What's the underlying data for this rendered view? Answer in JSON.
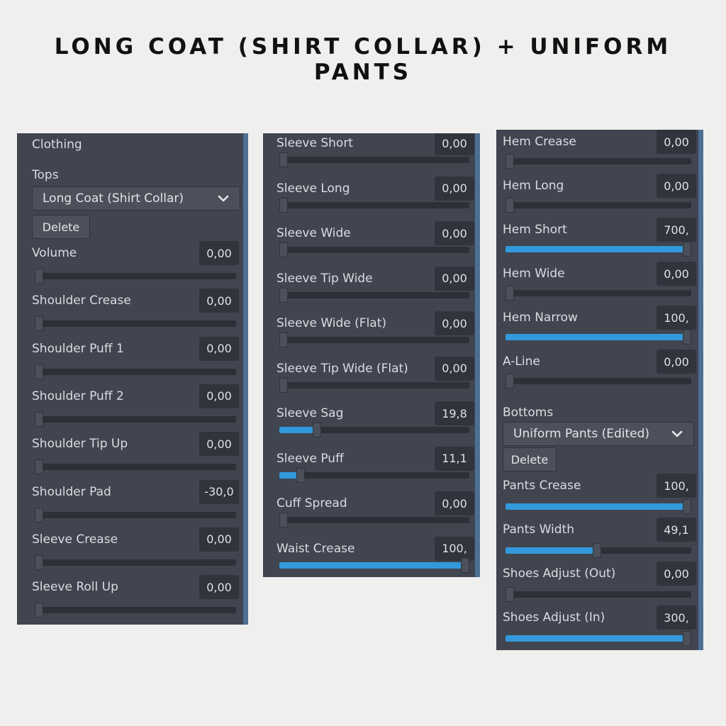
{
  "title": "LONG COAT (SHIRT COLLAR) + UNIFORM PANTS",
  "panel1": {
    "header": "Clothing",
    "section": "Tops",
    "dropdown": "Long Coat (Shirt Collar)",
    "delete": "Delete",
    "sliders": [
      {
        "label": "Volume",
        "value": "0,00",
        "fraction": 0
      },
      {
        "label": "Shoulder Crease",
        "value": "0,00",
        "fraction": 0
      },
      {
        "label": "Shoulder Puff 1",
        "value": "0,00",
        "fraction": 0
      },
      {
        "label": "Shoulder Puff 2",
        "value": "0,00",
        "fraction": 0
      },
      {
        "label": "Shoulder Tip Up",
        "value": "0,00",
        "fraction": 0
      },
      {
        "label": "Shoulder Pad",
        "value": "-30,0",
        "fraction": 0
      },
      {
        "label": "Sleeve Crease",
        "value": "0,00",
        "fraction": 0
      },
      {
        "label": "Sleeve Roll Up",
        "value": "0,00",
        "fraction": 0
      }
    ]
  },
  "panel2": {
    "sliders": [
      {
        "label": "Sleeve Short",
        "value": "0,00",
        "fraction": 0
      },
      {
        "label": "Sleeve Long",
        "value": "0,00",
        "fraction": 0
      },
      {
        "label": "Sleeve Wide",
        "value": "0,00",
        "fraction": 0
      },
      {
        "label": "Sleeve Tip Wide",
        "value": "0,00",
        "fraction": 0
      },
      {
        "label": "Sleeve Wide (Flat)",
        "value": "0,00",
        "fraction": 0
      },
      {
        "label": "Sleeve Tip Wide (Flat)",
        "value": "0,00",
        "fraction": 0
      },
      {
        "label": "Sleeve Sag",
        "value": "19,8",
        "fraction": 0.198
      },
      {
        "label": "Sleeve Puff",
        "value": "11,1",
        "fraction": 0.111
      },
      {
        "label": "Cuff Spread",
        "value": "0,00",
        "fraction": 0
      },
      {
        "label": "Waist Crease",
        "value": "100,",
        "fraction": 1
      }
    ]
  },
  "panel3": {
    "sliders_top": [
      {
        "label": "Hem Crease",
        "value": "0,00",
        "fraction": 0
      },
      {
        "label": "Hem Long",
        "value": "0,00",
        "fraction": 0
      },
      {
        "label": "Hem Short",
        "value": "700,",
        "fraction": 1
      },
      {
        "label": "Hem Wide",
        "value": "0,00",
        "fraction": 0
      },
      {
        "label": "Hem Narrow",
        "value": "100,",
        "fraction": 1
      },
      {
        "label": "A-Line",
        "value": "0,00",
        "fraction": 0
      }
    ],
    "section": "Bottoms",
    "dropdown": "Uniform Pants (Edited)",
    "delete": "Delete",
    "sliders_bottom": [
      {
        "label": "Pants Crease",
        "value": "100,",
        "fraction": 1
      },
      {
        "label": "Pants Width",
        "value": "49,1",
        "fraction": 0.491
      },
      {
        "label": "Shoes Adjust (Out)",
        "value": "0,00",
        "fraction": 0
      },
      {
        "label": "Shoes Adjust (In)",
        "value": "300,",
        "fraction": 1
      }
    ]
  }
}
